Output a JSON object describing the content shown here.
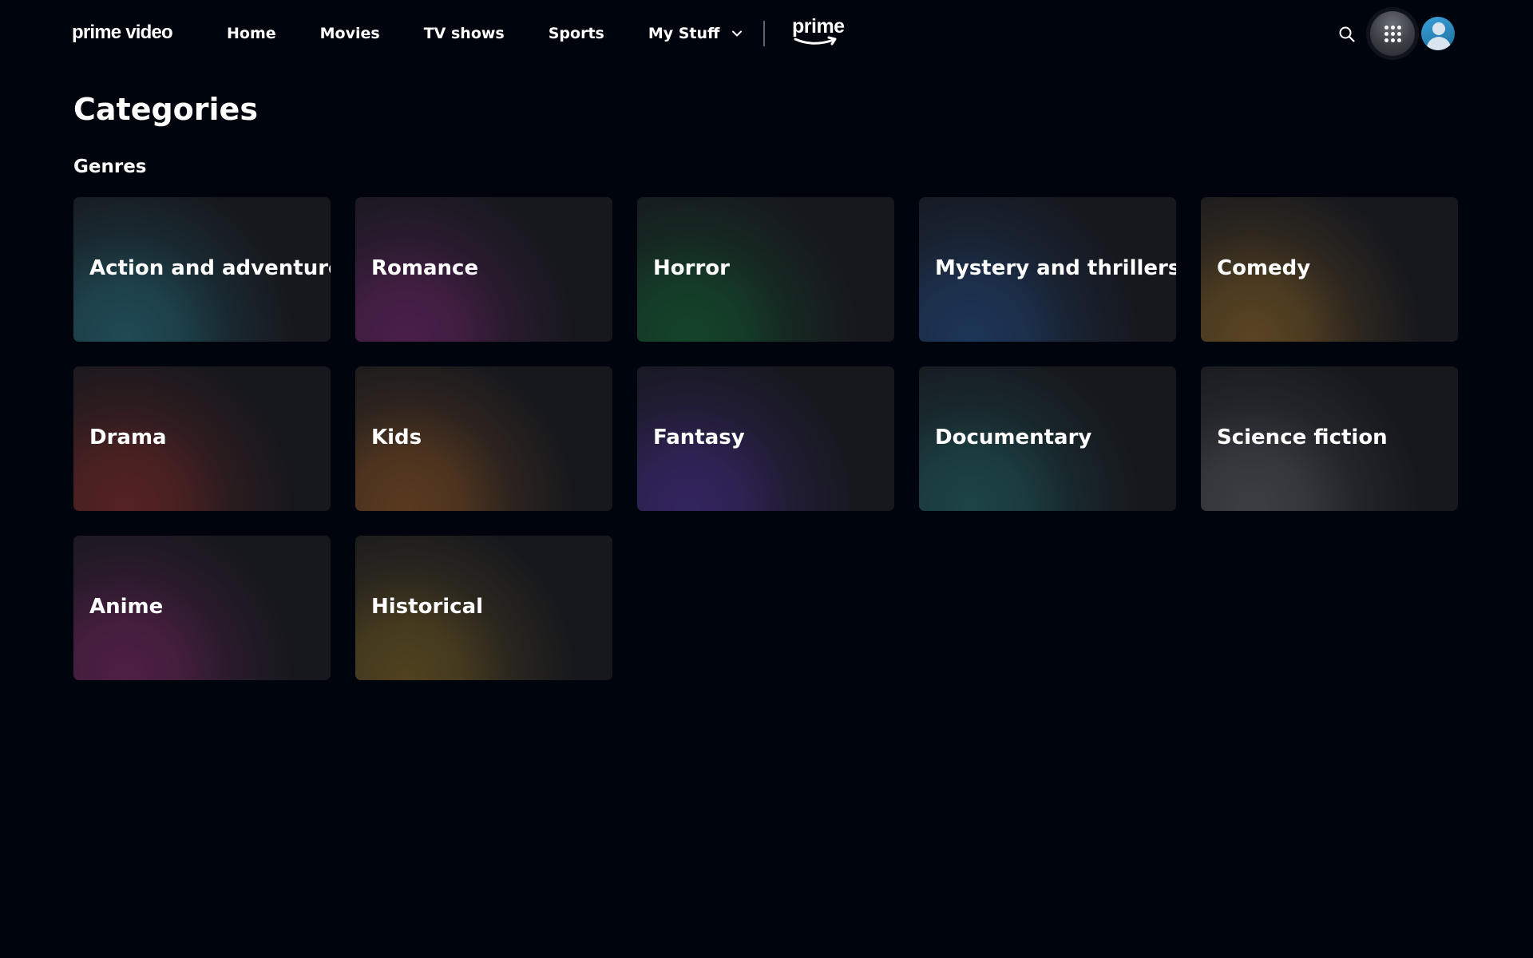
{
  "header": {
    "logo_text": "prime video",
    "nav": [
      {
        "label": "Home"
      },
      {
        "label": "Movies"
      },
      {
        "label": "TV shows"
      },
      {
        "label": "Sports"
      },
      {
        "label": "My Stuff"
      }
    ],
    "prime_badge_text": "prime"
  },
  "main": {
    "title": "Categories",
    "section_title": "Genres",
    "categories": [
      {
        "label": "Action and adventure",
        "color": "#1f4a55"
      },
      {
        "label": "Romance",
        "color": "#4a1f4a"
      },
      {
        "label": "Horror",
        "color": "#14442a"
      },
      {
        "label": "Mystery and thrillers",
        "color": "#1d3557"
      },
      {
        "label": "Comedy",
        "color": "#5a4422"
      },
      {
        "label": "Drama",
        "color": "#552222"
      },
      {
        "label": "Kids",
        "color": "#5a3a1f"
      },
      {
        "label": "Fantasy",
        "color": "#33245e"
      },
      {
        "label": "Documentary",
        "color": "#1c4447"
      },
      {
        "label": "Science fiction",
        "color": "#3d3d44"
      },
      {
        "label": "Anime",
        "color": "#4f1f45"
      },
      {
        "label": "Historical",
        "color": "#50421f"
      }
    ]
  }
}
